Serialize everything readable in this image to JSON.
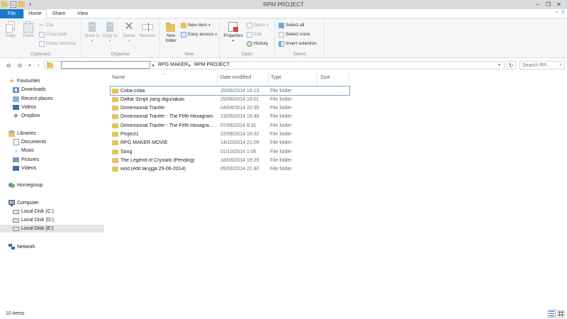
{
  "window": {
    "title": "RPM PROJECT"
  },
  "tabs": [
    {
      "label": "File"
    },
    {
      "label": "Home"
    },
    {
      "label": "Share"
    },
    {
      "label": "View"
    }
  ],
  "ribbon": {
    "clipboard": {
      "label": "Clipboard",
      "copy": "Copy",
      "paste": "Paste",
      "cut": "Cut",
      "copy_path": "Copy path",
      "paste_shortcut": "Paste shortcut"
    },
    "organise": {
      "label": "Organise",
      "move_to": "Move to",
      "copy_to": "Copy to",
      "delete": "Delete",
      "rename": "Rename"
    },
    "new": {
      "label": "New",
      "new_folder": "New folder",
      "new_item": "New item",
      "easy_access": "Easy access"
    },
    "open": {
      "label": "Open",
      "properties": "Properties",
      "open": "Open",
      "edit": "Edit",
      "history": "History"
    },
    "select": {
      "label": "Select",
      "select_all": "Select all",
      "select_none": "Select none",
      "invert_selection": "Invert selection"
    }
  },
  "address": {
    "crumbs": [
      "RPG MAKER",
      "RPM PROJECT"
    ],
    "search_placeholder": "Search RP..."
  },
  "nav": {
    "favourites": {
      "label": "Favourites",
      "items": [
        "Downloads",
        "Recent places",
        "Videos",
        "Dropbox"
      ]
    },
    "libraries": {
      "label": "Libraries",
      "items": [
        "Documents",
        "Music",
        "Pictures",
        "Videos"
      ]
    },
    "homegroup": "Homegroup",
    "computer": {
      "label": "Computer",
      "items": [
        "Local Disk (C:)",
        "Local Disk (D:)",
        "Local Disk (E:)"
      ]
    },
    "network": "Network"
  },
  "columns": {
    "name": "Name",
    "date": "Date modified",
    "type": "Type",
    "size": "Size"
  },
  "files": [
    {
      "name": "Coba-coba",
      "date": "25/06/2014 16:13",
      "type": "File folder"
    },
    {
      "name": "Daftar Script yang digunakan",
      "date": "25/06/2014 18:01",
      "type": "File folder"
    },
    {
      "name": "Dimensional Tranfer",
      "date": "04/04/2014 22:35",
      "type": "File folder"
    },
    {
      "name": "Dimensional Tranfer - The Fifth Hexagram",
      "date": "13/05/2014 19:48",
      "type": "File folder"
    },
    {
      "name": "Dimensional Tranfer - The Fifth Hexagra...",
      "date": "07/06/2014 8:31",
      "type": "File folder"
    },
    {
      "name": "Project1",
      "date": "22/09/2014 18:32",
      "type": "File folder"
    },
    {
      "name": "RPG MAKER MOVIE",
      "date": "14/10/2014 21:09",
      "type": "File folder"
    },
    {
      "name": "Song",
      "date": "01/10/2014 1:06",
      "type": "File folder"
    },
    {
      "name": "The Legend of Crystals (Pending)",
      "date": "18/03/2014 19:29",
      "type": "File folder"
    },
    {
      "name": "wod (edit tangga 29-06-2014)",
      "date": "05/09/2014 21:40",
      "type": "File folder"
    }
  ],
  "status": {
    "count": "10 items"
  },
  "colors": {
    "accent": "#1979ca",
    "folder": "#e8c25e",
    "selection_border": "#7da2ce"
  }
}
